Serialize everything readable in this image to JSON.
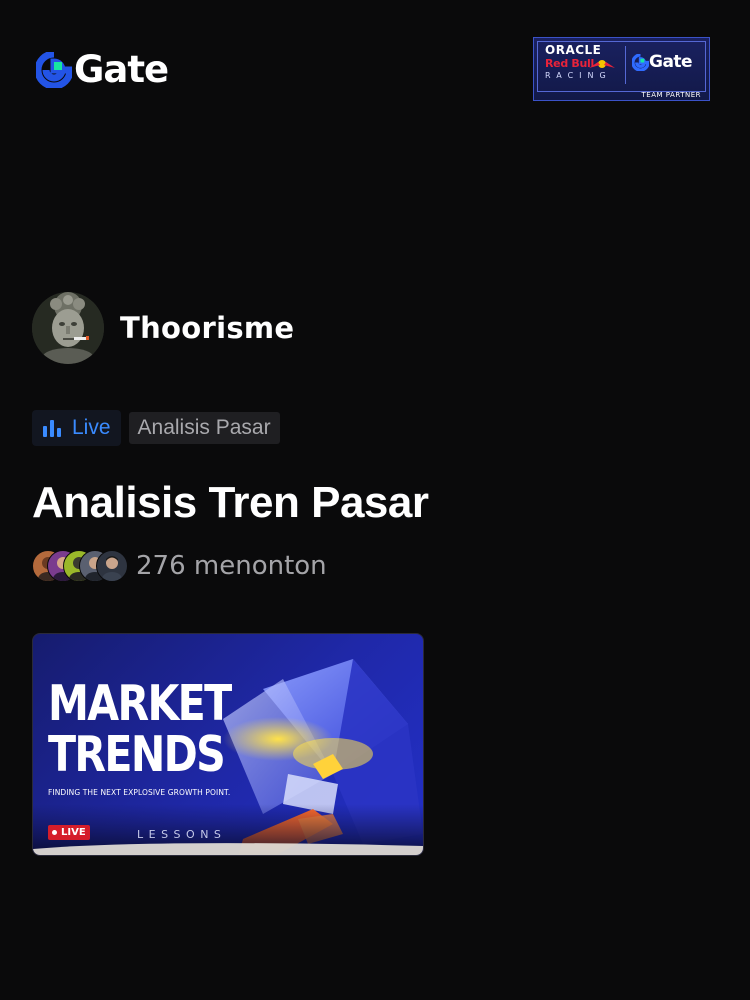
{
  "header": {
    "brand_name": "Gate",
    "brand_icon": "gate-logo-icon",
    "partner": {
      "line1": "ORACLE",
      "line2": "Red Bull",
      "line3": "RACING",
      "partner_brand": "Gate",
      "caption": "TEAM PARTNER"
    }
  },
  "stream": {
    "author": "Thoorisme",
    "tags": {
      "live_label": "Live",
      "category": "Analisis Pasar"
    },
    "title": "Analisis Tren Pasar",
    "viewers_text": "276 menonton",
    "cover": {
      "title_line1": "MARKET",
      "title_line2": "TRENDS",
      "subtitle": "FINDING THE NEXT EXPLOSIVE GROWTH POINT.",
      "live_badge": "LIVE",
      "lessons": "LESSONS"
    }
  },
  "colors": {
    "background": "#0a0a0b",
    "brand_blue": "#2354e6",
    "brand_green": "#17e6a1",
    "live_blue": "#3a8bff",
    "live_red": "#d51d2a"
  }
}
